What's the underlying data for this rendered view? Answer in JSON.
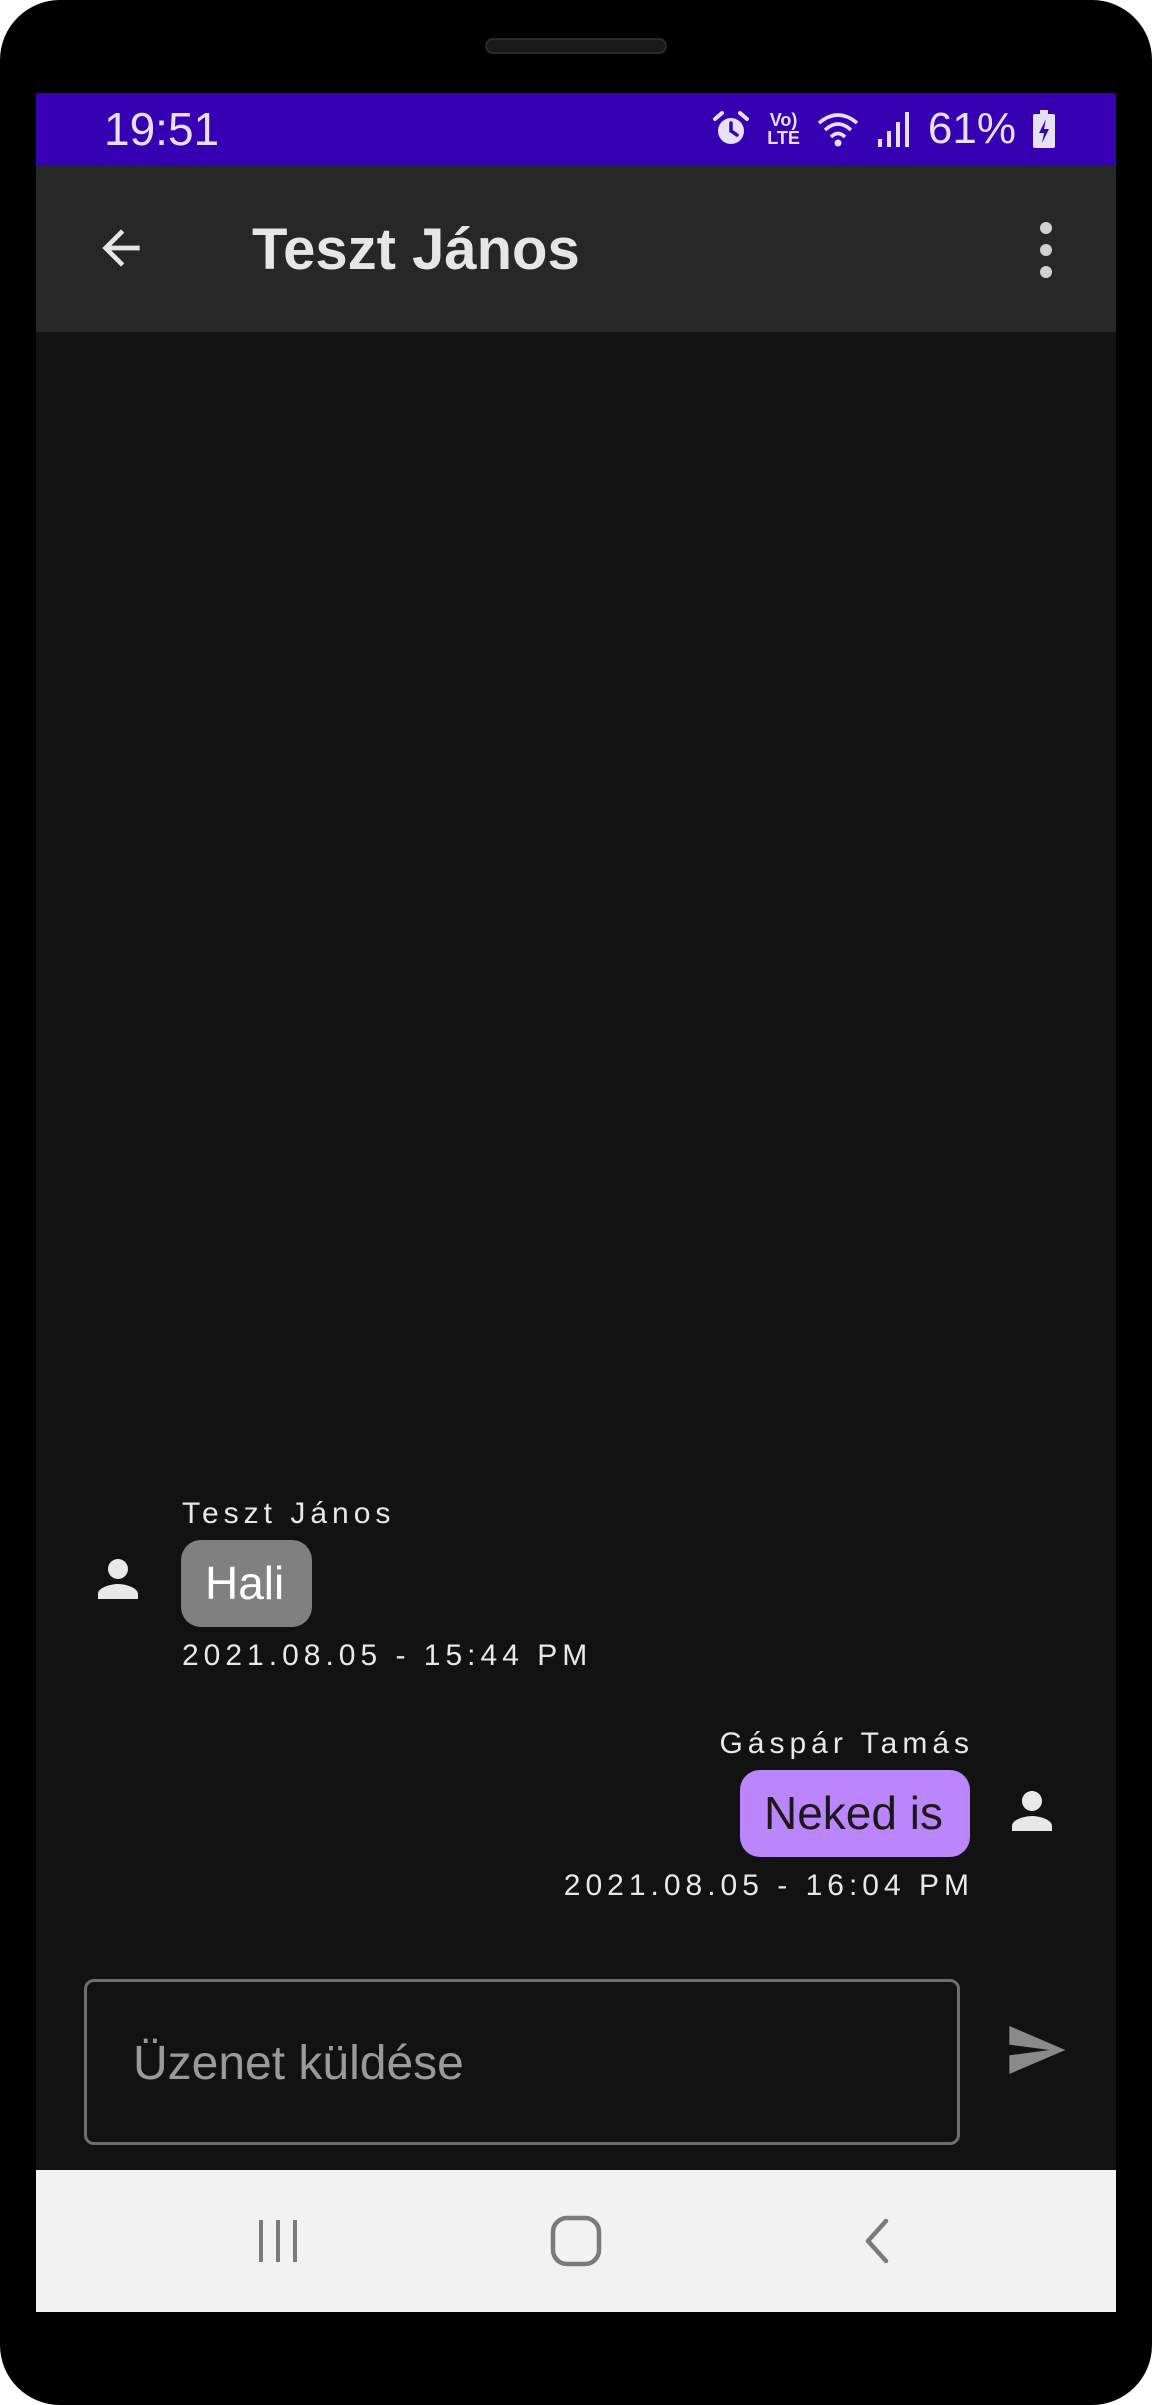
{
  "status_bar": {
    "time": "19:51",
    "battery_percent": "61%",
    "icons": [
      "alarm-icon",
      "volte-icon",
      "wifi-icon",
      "signal-icon",
      "battery-charging-icon"
    ],
    "volte_line1": "Vo)",
    "volte_line2": "LTE",
    "background_color": "#3700b3"
  },
  "app_bar": {
    "title": "Teszt János",
    "back_icon": "arrow-back-icon",
    "menu_icon": "more-vert-icon"
  },
  "messages": [
    {
      "sender": "Teszt János",
      "text": "Hali",
      "timestamp": "2021.08.05 - 15:44 PM",
      "direction": "incoming",
      "bubble_color": "#808080"
    },
    {
      "sender": "Gáspár Tamás",
      "text": "Neked is",
      "timestamp": "2021.08.05 - 16:04 PM",
      "direction": "outgoing",
      "bubble_color": "#bb86fc"
    }
  ],
  "composer": {
    "value": "",
    "placeholder": "Üzenet küldése",
    "send_icon": "send-icon"
  },
  "nav_bar": {
    "icons": [
      "recent-apps-icon",
      "home-icon",
      "back-nav-icon"
    ]
  }
}
